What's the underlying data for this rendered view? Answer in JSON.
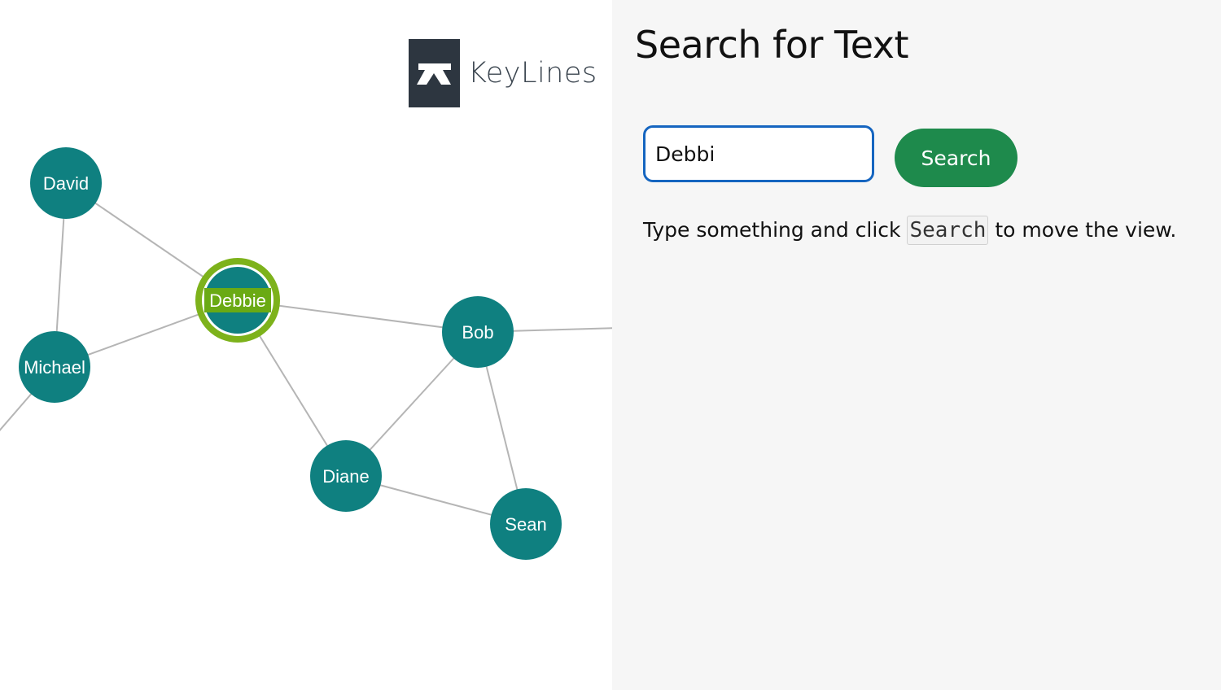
{
  "logo": {
    "text": "KeyLines",
    "icon": "keylines-logo-icon"
  },
  "panel": {
    "title": "Search for Text",
    "search": {
      "value": "Debbi",
      "placeholder": ""
    },
    "search_button_label": "Search",
    "help": {
      "before": "Type something and click",
      "code": "Search",
      "after": "to move the view."
    }
  },
  "colors": {
    "node_fill": "#0f8080",
    "node_label": "#ffffff",
    "selection_ring": "#7db21b",
    "label_highlight": "#6aaa14",
    "link": "#b5b5b5",
    "search_button": "#1e8a4c",
    "input_focus_border": "#1565c0"
  },
  "graph": {
    "nodes": [
      {
        "id": "david",
        "label": "David",
        "selected": false
      },
      {
        "id": "debbie",
        "label": "Debbie",
        "selected": true,
        "label_highlighted": true
      },
      {
        "id": "michael",
        "label": "Michael",
        "selected": false
      },
      {
        "id": "bob",
        "label": "Bob",
        "selected": false
      },
      {
        "id": "diane",
        "label": "Diane",
        "selected": false
      },
      {
        "id": "sean",
        "label": "Sean",
        "selected": false
      }
    ],
    "links": [
      {
        "from": "david",
        "to": "debbie"
      },
      {
        "from": "david",
        "to": "michael"
      },
      {
        "from": "michael",
        "to": "debbie"
      },
      {
        "from": "debbie",
        "to": "bob"
      },
      {
        "from": "debbie",
        "to": "diane"
      },
      {
        "from": "bob",
        "to": "diane"
      },
      {
        "from": "bob",
        "to": "sean"
      },
      {
        "from": "diane",
        "to": "sean"
      },
      {
        "from": "michael",
        "to": "offscreen-left"
      },
      {
        "from": "bob",
        "to": "offscreen-right"
      }
    ]
  }
}
